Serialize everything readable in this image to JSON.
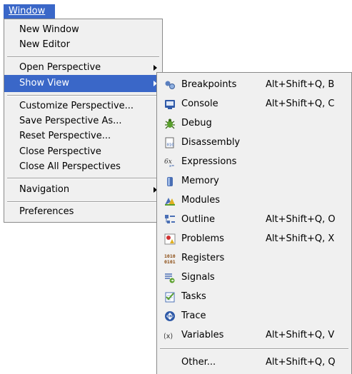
{
  "menubar": {
    "window_label": "Window"
  },
  "main_menu": {
    "items": [
      {
        "label": "New Window"
      },
      {
        "label": "New Editor"
      },
      {
        "label": "Open Perspective"
      },
      {
        "label": "Show View"
      },
      {
        "label": "Customize Perspective..."
      },
      {
        "label": "Save Perspective As..."
      },
      {
        "label": "Reset Perspective..."
      },
      {
        "label": "Close Perspective"
      },
      {
        "label": "Close All Perspectives"
      },
      {
        "label": "Navigation"
      },
      {
        "label": "Preferences"
      }
    ]
  },
  "show_view_menu": {
    "items": [
      {
        "label": "Breakpoints",
        "shortcut": "Alt+Shift+Q, B",
        "icon": "breakpoints-icon"
      },
      {
        "label": "Console",
        "shortcut": "Alt+Shift+Q, C",
        "icon": "console-icon"
      },
      {
        "label": "Debug",
        "shortcut": "",
        "icon": "debug-icon"
      },
      {
        "label": "Disassembly",
        "shortcut": "",
        "icon": "disassembly-icon"
      },
      {
        "label": "Expressions",
        "shortcut": "",
        "icon": "expressions-icon"
      },
      {
        "label": "Memory",
        "shortcut": "",
        "icon": "memory-icon"
      },
      {
        "label": "Modules",
        "shortcut": "",
        "icon": "modules-icon"
      },
      {
        "label": "Outline",
        "shortcut": "Alt+Shift+Q, O",
        "icon": "outline-icon"
      },
      {
        "label": "Problems",
        "shortcut": "Alt+Shift+Q, X",
        "icon": "problems-icon"
      },
      {
        "label": "Registers",
        "shortcut": "",
        "icon": "registers-icon"
      },
      {
        "label": "Signals",
        "shortcut": "",
        "icon": "signals-icon"
      },
      {
        "label": "Tasks",
        "shortcut": "",
        "icon": "tasks-icon"
      },
      {
        "label": "Trace",
        "shortcut": "",
        "icon": "trace-icon"
      },
      {
        "label": "Variables",
        "shortcut": "Alt+Shift+Q, V",
        "icon": "variables-icon"
      },
      {
        "label": "Other...",
        "shortcut": "Alt+Shift+Q, Q"
      }
    ]
  },
  "colors": {
    "selection": "#3a67c8",
    "menu_bg": "#f0f0f0"
  }
}
